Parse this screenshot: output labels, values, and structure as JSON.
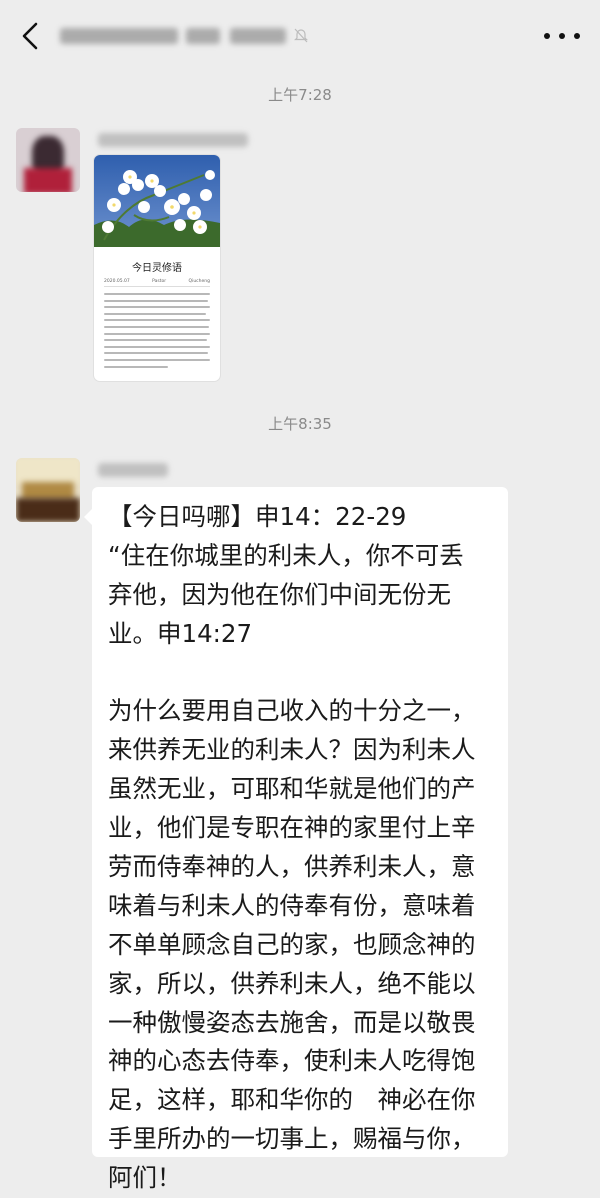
{
  "header": {
    "back_icon": "chevron-left-icon",
    "mute_icon": "bell-muted-icon",
    "more_icon": "more-dots-icon"
  },
  "messages": [
    {
      "timestamp": "上午7:28",
      "type": "image",
      "card": {
        "heading": "今日灵修语",
        "meta": [
          "2020.05.07",
          "Pastor",
          "Qiucheng"
        ]
      }
    },
    {
      "timestamp": "上午8:35",
      "type": "text",
      "lines": [
        "【今日吗哪】申14：22-29",
        "“住在你城里的利未人，你不可丢",
        "弃他，因为他在你们中间无份无",
        "业。申14:27",
        "",
        "为什么要用自己收入的十分之一，",
        "来供养无业的利未人？因为利未人",
        "虽然无业，可耶和华就是他们的产",
        "业，他们是专职在神的家里付上辛",
        "劳而侍奉神的人，供养利未人，意",
        "味着与利未人的侍奉有份，意味着",
        "不单单顾念自己的家，也顾念神的",
        "家，所以，供养利未人，绝不能以",
        "一种傲慢姿态去施舍，而是以敬畏",
        "神的心态去侍奉，使利未人吃得饱",
        "足，这样，耶和华你的　神必在你",
        "手里所办的一切事上，赐福与你，",
        "阿们！"
      ]
    }
  ]
}
